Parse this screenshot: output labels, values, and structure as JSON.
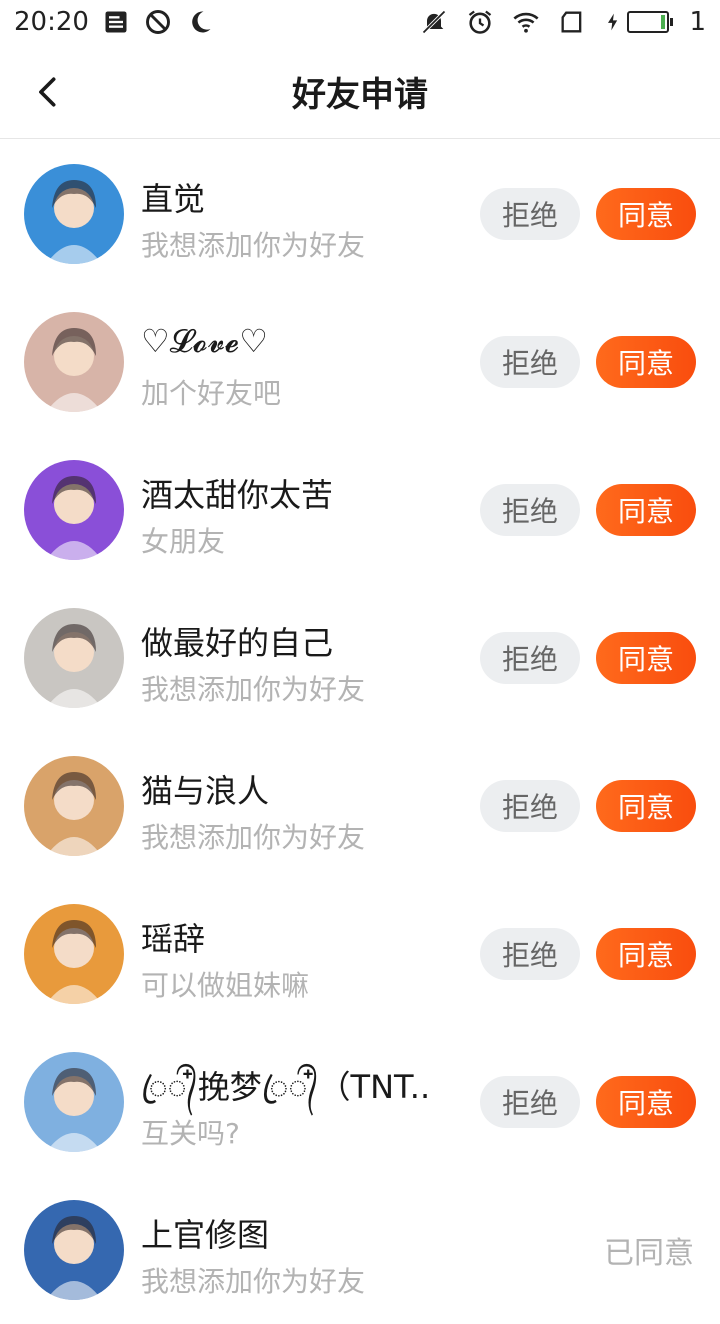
{
  "status_bar": {
    "time": "20:20",
    "battery_level": "1",
    "icons_left": [
      "notification-icon",
      "block-icon",
      "moon-icon"
    ],
    "icons_right": [
      "mute-bell-icon",
      "alarm-icon",
      "wifi-icon",
      "sim-icon",
      "charging-icon",
      "battery-icon"
    ]
  },
  "header": {
    "title": "好友申请",
    "back_icon": "chevron-left-icon"
  },
  "buttons": {
    "reject": "拒绝",
    "accept": "同意",
    "accepted": "已同意"
  },
  "requests": [
    {
      "name": "直觉",
      "message": "我想添加你为好友",
      "status": "pending",
      "avatar_color": "#3a8fd8"
    },
    {
      "name": "♡𝓛𝓸𝓿𝓮♡",
      "message": "加个好友吧",
      "status": "pending",
      "avatar_color": "#d7b4a8"
    },
    {
      "name": "酒太甜你太苦",
      "message": "女朋友",
      "status": "pending",
      "avatar_color": "#8a4fd8"
    },
    {
      "name": "做最好的自己",
      "message": "我想添加你为好友",
      "status": "pending",
      "avatar_color": "#c9c6c2"
    },
    {
      "name": "猫与浪人",
      "message": "我想添加你为好友",
      "status": "pending",
      "avatar_color": "#d9a36a"
    },
    {
      "name": "瑶辞",
      "message": "可以做姐妹嘛",
      "status": "pending",
      "avatar_color": "#e89a3c"
    },
    {
      "name": "ꦿ᭄໋挽梦ꦿ᭄໋（TNT..",
      "message": "互关吗?",
      "status": "pending",
      "avatar_color": "#7fb0e0"
    },
    {
      "name": "上官修图",
      "message": "我想添加你为好友",
      "status": "accepted",
      "avatar_color": "#3568b0"
    }
  ]
}
